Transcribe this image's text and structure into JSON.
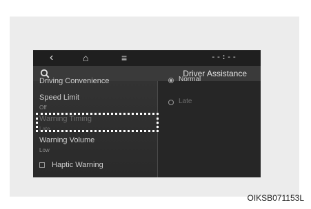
{
  "nav": {
    "back_icon": "chevron-left-icon",
    "home_icon": "home-icon",
    "menu_icon": "menu-icon",
    "clock": "--:--"
  },
  "header": {
    "title": "Driver Assistance"
  },
  "menu": {
    "items": [
      {
        "label": "Driving Convenience"
      },
      {
        "label": "Speed Limit",
        "value": "Off"
      },
      {
        "label": "Warning Timing",
        "value": "Late"
      },
      {
        "label": "Warning Volume",
        "value": "Low"
      },
      {
        "label": "Haptic Warning",
        "checked": false
      }
    ]
  },
  "options": {
    "items": [
      {
        "label": "Normal",
        "selected": true
      },
      {
        "label": "Late",
        "selected": false
      }
    ]
  },
  "figure_code": "OIKSB071153L",
  "colors": {
    "screen_bg": "#2b2b2b",
    "topbar_bg": "#1f1f1f",
    "highlight_dots": "#ffffff"
  }
}
